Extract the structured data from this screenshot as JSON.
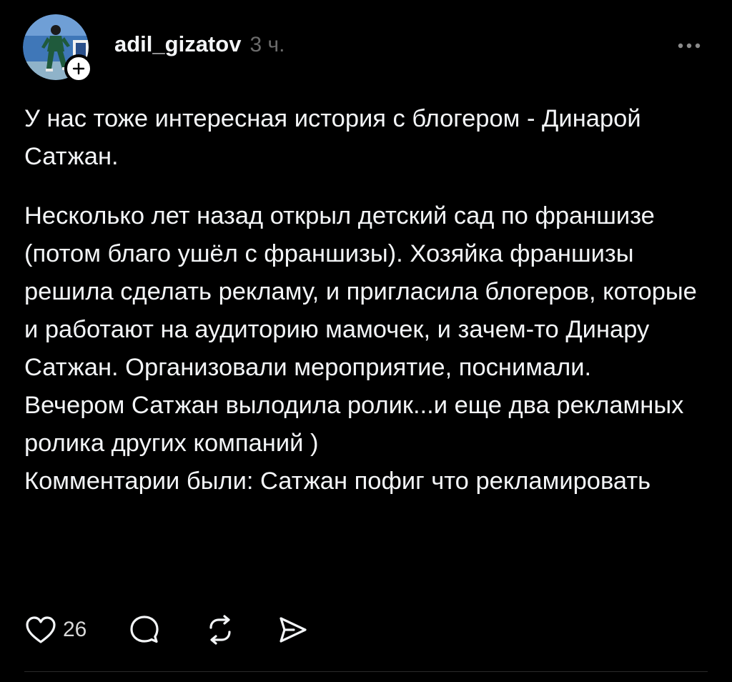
{
  "post": {
    "username": "adil_gizatov",
    "timestamp": "3 ч.",
    "paragraphs": [
      "У нас тоже интересная история с блогером - Динарой Сатжан.",
      "Несколько лет назад открыл детский сад по франшизе (потом благо ушёл с франшизы). Хозяйка франшизы решила сделать рекламу, и пригласила блогеров, которые и работают на аудиторию мамочек, и зачем-то Динару Сатжан. Организовали мероприятие, поснимали.",
      "Вечером Сатжан вылодила ролик...и еще два рекламных ролика других компаний )",
      "Комментарии были: Сатжан пофиг что рекламировать"
    ],
    "like_count": "26"
  },
  "icons": {
    "follow": "plus-icon",
    "more": "more-horizontal-icon",
    "like": "heart-icon",
    "comment": "comment-icon",
    "repost": "repost-icon",
    "share": "send-icon"
  },
  "colors": {
    "background": "#000000",
    "text": "#f3f5f7",
    "muted": "#6b6b6b",
    "divider": "#2b2b2b"
  }
}
